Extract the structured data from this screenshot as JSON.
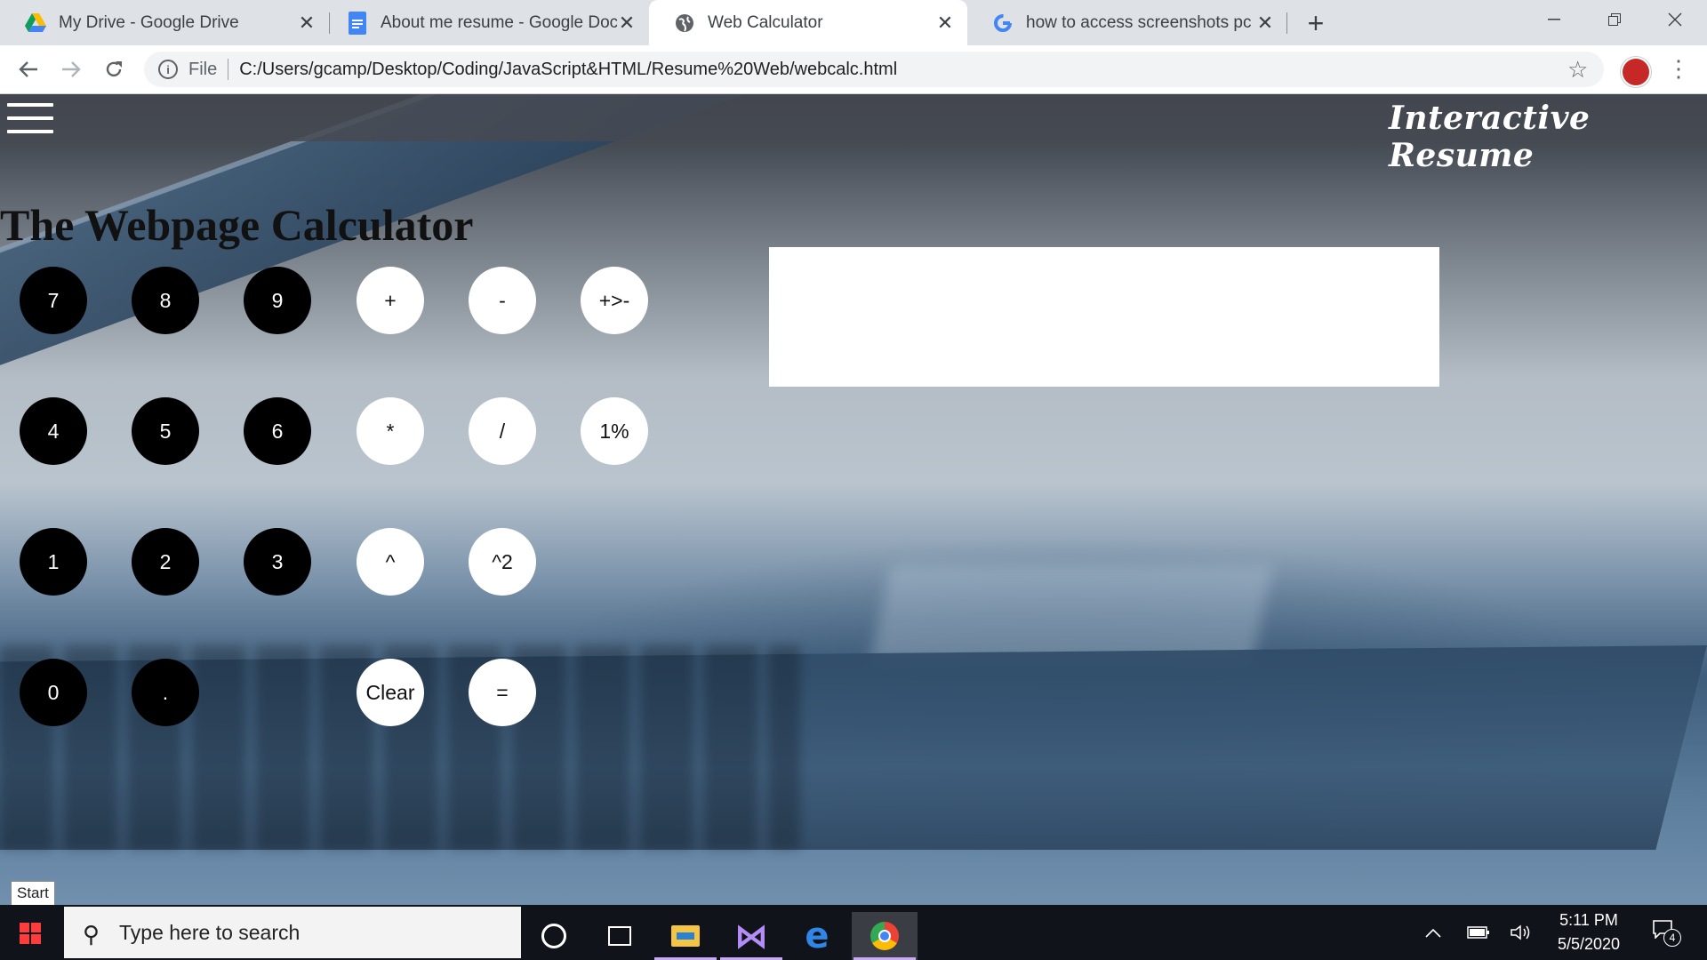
{
  "browser": {
    "tabs": [
      {
        "title": "My Drive - Google Drive",
        "icon": "google-drive-icon",
        "active": false
      },
      {
        "title": "About me resume - Google Docs",
        "icon": "google-docs-icon",
        "active": false
      },
      {
        "title": "Web Calculator",
        "icon": "globe-icon",
        "active": true
      },
      {
        "title": "how to access screenshots pc - G",
        "icon": "google-icon",
        "active": false
      }
    ],
    "address": {
      "scheme_label": "File",
      "url": "C:/Users/gcamp/Desktop/Coding/JavaScript&HTML/Resume%20Web/webcalc.html"
    }
  },
  "site": {
    "brand": "Interactive Resume"
  },
  "page": {
    "title": "The Webpage Calculator",
    "display_value": ""
  },
  "keypad": [
    {
      "label": "7",
      "style": "dark"
    },
    {
      "label": "8",
      "style": "dark"
    },
    {
      "label": "9",
      "style": "dark"
    },
    {
      "label": "+",
      "style": "light"
    },
    {
      "label": "-",
      "style": "light"
    },
    {
      "label": "+>-",
      "style": "light"
    },
    {
      "label": "4",
      "style": "dark"
    },
    {
      "label": "5",
      "style": "dark"
    },
    {
      "label": "6",
      "style": "dark"
    },
    {
      "label": "*",
      "style": "light"
    },
    {
      "label": "/",
      "style": "light"
    },
    {
      "label": "1%",
      "style": "light"
    },
    {
      "label": "1",
      "style": "dark"
    },
    {
      "label": "2",
      "style": "dark"
    },
    {
      "label": "3",
      "style": "dark"
    },
    {
      "label": "^",
      "style": "light"
    },
    {
      "label": "^2",
      "style": "light"
    },
    {
      "label": "0",
      "style": "dark"
    },
    {
      "label": ".",
      "style": "dark"
    },
    {
      "label": "Clear",
      "style": "light"
    },
    {
      "label": "=",
      "style": "light"
    }
  ],
  "tooltip": {
    "start": "Start"
  },
  "taskbar": {
    "search_placeholder": "Type here to search",
    "time": "5:11 PM",
    "date": "5/5/2020",
    "notification_count": "4",
    "pinned": [
      "cortana-icon",
      "task-view-icon",
      "file-explorer-icon",
      "visual-studio-icon",
      "edge-icon",
      "chrome-icon"
    ]
  }
}
